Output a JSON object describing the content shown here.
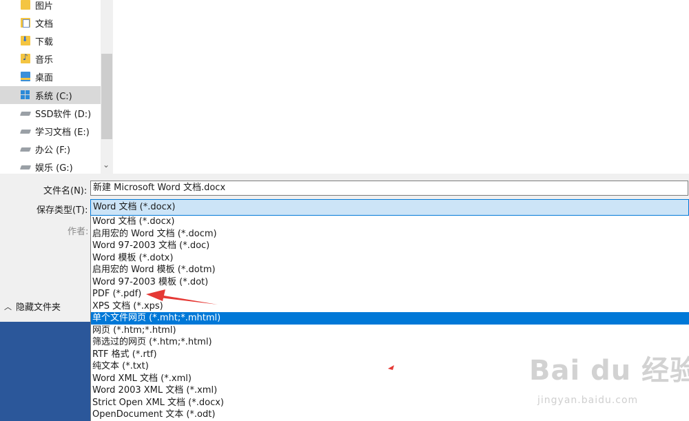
{
  "navigation": {
    "items": [
      {
        "label": "图片",
        "icon": "pictures-folder-icon"
      },
      {
        "label": "文档",
        "icon": "documents-folder-icon"
      },
      {
        "label": "下载",
        "icon": "downloads-folder-icon"
      },
      {
        "label": "音乐",
        "icon": "music-folder-icon"
      },
      {
        "label": "桌面",
        "icon": "desktop-folder-icon"
      },
      {
        "label": "系统 (C:)",
        "icon": "windows-drive-icon",
        "selected": true
      },
      {
        "label": "SSD软件 (D:)",
        "icon": "drive-icon"
      },
      {
        "label": "学习文档 (E:)",
        "icon": "drive-icon"
      },
      {
        "label": "办公 (F:)",
        "icon": "drive-icon"
      },
      {
        "label": "娱乐 (G:)",
        "icon": "drive-icon"
      }
    ]
  },
  "form": {
    "filename_label": "文件名(N):",
    "filename_value": "新建 Microsoft Word 文档.docx",
    "filetype_label": "保存类型(T):",
    "filetype_value": "Word 文档 (*.docx)",
    "author_label": "作者:",
    "hide_folders_label": "隐藏文件夹"
  },
  "filetype_options": [
    "Word 文档 (*.docx)",
    "启用宏的 Word 文档 (*.docm)",
    "Word 97-2003 文档 (*.doc)",
    "Word 模板 (*.dotx)",
    "启用宏的 Word 模板 (*.dotm)",
    "Word 97-2003 模板 (*.dot)",
    "PDF (*.pdf)",
    "XPS 文档 (*.xps)",
    "单个文件网页 (*.mht;*.mhtml)",
    "网页 (*.htm;*.html)",
    "筛选过的网页 (*.htm;*.html)",
    "RTF 格式 (*.rtf)",
    "纯文本 (*.txt)",
    "Word XML 文档 (*.xml)",
    "Word 2003 XML 文档 (*.xml)",
    "Strict Open XML 文档 (*.docx)",
    "OpenDocument 文本 (*.odt)"
  ],
  "highlighted_option_index": 8,
  "watermark": {
    "brand": "Bai du 经验",
    "url": "jingyan.baidu.com"
  },
  "colors": {
    "highlight": "#0078d7",
    "app_background": "#2b579a",
    "annotation_arrow": "#e53935"
  }
}
